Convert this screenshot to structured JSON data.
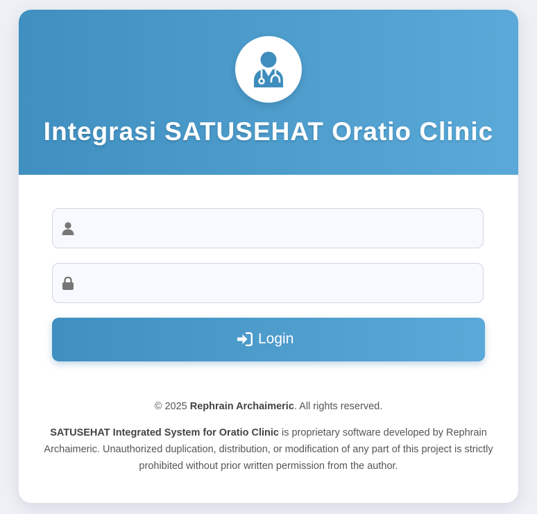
{
  "app": {
    "title": "Integrasi SATUSEHAT Oratio Clinic"
  },
  "form": {
    "username": {
      "value": "",
      "placeholder": ""
    },
    "password": {
      "value": "",
      "placeholder": ""
    },
    "login_label": "Login"
  },
  "footer": {
    "copyright_prefix": "© 2025 ",
    "copyright_author": "Rephrain Archaimeric",
    "copyright_suffix": ". All rights reserved.",
    "notice_product": "SATUSEHAT Integrated System for Oratio Clinic",
    "notice_text": " is proprietary software developed by Rephrain Archaimeric. Unauthorized duplication, distribution, or modification of any part of this project is strictly prohibited without prior written permission from the author."
  },
  "icons": {
    "avatar": "doctor-icon",
    "username": "user-icon",
    "password": "lock-icon",
    "login": "sign-in-icon"
  },
  "colors": {
    "header_gradient_start": "#3f8fc0",
    "header_gradient_end": "#5aa9d8",
    "icon_blue": "#3e8dbd",
    "input_icon_gray": "#777777"
  }
}
